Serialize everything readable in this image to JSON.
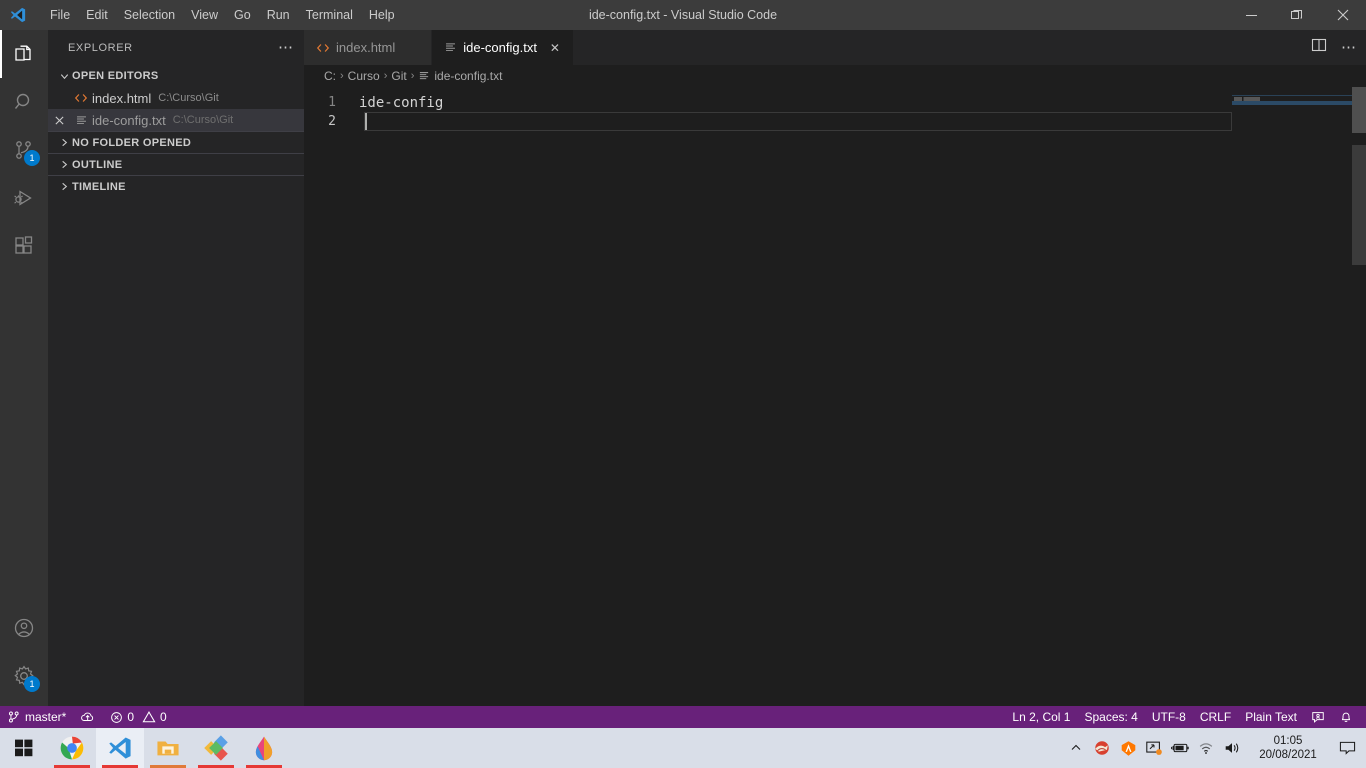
{
  "window": {
    "title": "ide-config.txt - Visual Studio Code",
    "logo_icon": "vscode-logo-icon",
    "controls": [
      {
        "name": "minimize-button",
        "icon": "minimize-icon"
      },
      {
        "name": "restore-button",
        "icon": "restore-icon"
      },
      {
        "name": "close-button",
        "icon": "close-icon"
      }
    ]
  },
  "menubar": {
    "items": [
      "File",
      "Edit",
      "Selection",
      "View",
      "Go",
      "Run",
      "Terminal",
      "Help"
    ]
  },
  "activitybar": {
    "items": [
      {
        "name": "explorer",
        "icon": "files-icon",
        "active": true,
        "badge": ""
      },
      {
        "name": "search",
        "icon": "search-icon",
        "active": false,
        "badge": ""
      },
      {
        "name": "source-control",
        "icon": "source-control-icon",
        "active": false,
        "badge": "1"
      },
      {
        "name": "run-and-debug",
        "icon": "run-debug-icon",
        "active": false,
        "badge": ""
      },
      {
        "name": "extensions",
        "icon": "extensions-icon",
        "active": false,
        "badge": ""
      }
    ],
    "bottom": [
      {
        "name": "accounts",
        "icon": "account-icon",
        "badge": ""
      },
      {
        "name": "manage",
        "icon": "gear-icon",
        "badge": "1"
      }
    ]
  },
  "sidebar": {
    "title": "EXPLORER",
    "more_actions_icon": "ellipsis-icon",
    "sections": [
      {
        "label": "OPEN EDITORS",
        "expanded": true,
        "chevron": "chevron-down-icon"
      },
      {
        "label": "NO FOLDER OPENED",
        "expanded": false,
        "chevron": "chevron-right-icon"
      },
      {
        "label": "OUTLINE",
        "expanded": false,
        "chevron": "chevron-right-icon"
      },
      {
        "label": "TIMELINE",
        "expanded": false,
        "chevron": "chevron-right-icon"
      }
    ],
    "open_editors": [
      {
        "label": "index.html",
        "description": "C:\\Curso\\Git",
        "icon": "html-file-icon",
        "selected": false,
        "close_icon": "close-icon"
      },
      {
        "label": "ide-config.txt",
        "description": "C:\\Curso\\Git",
        "icon": "text-file-icon",
        "selected": true,
        "close_icon": "close-icon"
      }
    ]
  },
  "editor": {
    "tabs": [
      {
        "label": "index.html",
        "icon": "html-file-icon",
        "active": false,
        "close_icon": "close-icon"
      },
      {
        "label": "ide-config.txt",
        "icon": "text-file-icon",
        "active": true,
        "close_icon": "close-icon"
      }
    ],
    "tab_actions": [
      {
        "name": "split-editor-button",
        "icon": "split-editor-icon"
      },
      {
        "name": "more-actions-button",
        "icon": "ellipsis-icon"
      }
    ],
    "breadcrumbs": [
      {
        "label": "C:",
        "icon": ""
      },
      {
        "label": "Curso",
        "icon": ""
      },
      {
        "label": "Git",
        "icon": ""
      },
      {
        "label": "ide-config.txt",
        "icon": "text-file-icon"
      }
    ],
    "breadcrumb_separator": "›",
    "lines": [
      {
        "number": "1",
        "text": "ide-config",
        "active": false
      },
      {
        "number": "2",
        "text": "",
        "active": true
      }
    ]
  },
  "statusbar": {
    "left": [
      {
        "name": "remote-indicator",
        "icon": "",
        "label": ""
      },
      {
        "name": "branch",
        "icon": "source-control-icon",
        "label": "master*"
      },
      {
        "name": "sync-changes",
        "icon": "cloud-upload-icon",
        "label": ""
      },
      {
        "name": "errors",
        "icon": "error-icon",
        "label": "0"
      },
      {
        "name": "warnings",
        "icon": "warning-icon",
        "label": "0"
      }
    ],
    "right": [
      {
        "name": "cursor-position",
        "icon": "",
        "label": "Ln 2, Col 1"
      },
      {
        "name": "indentation",
        "icon": "",
        "label": "Spaces: 4"
      },
      {
        "name": "encoding",
        "icon": "",
        "label": "UTF-8"
      },
      {
        "name": "line-endings",
        "icon": "",
        "label": "CRLF"
      },
      {
        "name": "language-mode",
        "icon": "",
        "label": "Plain Text"
      },
      {
        "name": "feedback",
        "icon": "feedback-icon",
        "label": ""
      },
      {
        "name": "notifications",
        "icon": "bell-icon",
        "label": ""
      }
    ]
  },
  "taskbar": {
    "start_icon": "windows-start-icon",
    "apps": [
      {
        "name": "chrome",
        "icon": "chrome-icon",
        "active": false,
        "underline": "#e53935"
      },
      {
        "name": "vscode",
        "icon": "vscode-icon",
        "active": true,
        "underline": "#e53935"
      },
      {
        "name": "file-explorer",
        "icon": "file-explorer-icon",
        "active": false,
        "underline": "#e07a3a"
      },
      {
        "name": "app-diamond",
        "icon": "diamond-app-icon",
        "active": false,
        "underline": "#e53935"
      },
      {
        "name": "app-paint-drop",
        "icon": "paint-drop-icon",
        "active": false,
        "underline": "#e53935"
      }
    ],
    "tray": [
      {
        "name": "show-hidden-icons",
        "icon": "chevron-up-icon"
      },
      {
        "name": "ccleaner",
        "icon": "ccleaner-icon"
      },
      {
        "name": "avast",
        "icon": "avast-icon"
      },
      {
        "name": "display-settings",
        "icon": "display-icon"
      },
      {
        "name": "battery",
        "icon": "battery-icon"
      },
      {
        "name": "network",
        "icon": "wifi-icon"
      },
      {
        "name": "volume",
        "icon": "speaker-icon"
      }
    ],
    "clock": {
      "time": "01:05",
      "date": "20/08/2021"
    },
    "notification_icon": "notification-icon"
  },
  "colors": {
    "titlebar_bg": "#3c3c3c",
    "activitybar_bg": "#333333",
    "sidebar_bg": "#252526",
    "editor_bg": "#1e1e1e",
    "statusbar_bg": "#68217a",
    "badge_bg": "#007acc",
    "taskbar_bg": "#d9dee8",
    "accent_orange": "#e37933"
  }
}
